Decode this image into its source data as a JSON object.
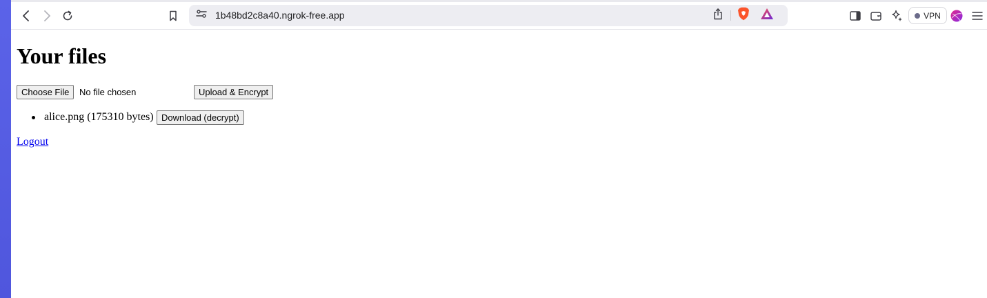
{
  "browser": {
    "url": "1b48bd2c8a40.ngrok-free.app",
    "vpn_label": "VPN",
    "icons": {
      "back": "chevron-left-icon",
      "forward": "chevron-right-icon",
      "reload": "reload-icon",
      "bookmark": "bookmark-icon",
      "site_settings": "tune-icon",
      "share": "share-icon",
      "brave_shields": "brave-lion-icon",
      "rewards": "rewards-triangle-icon",
      "sidebar": "sidebar-icon",
      "wallet": "wallet-icon",
      "leo": "sparkle-icon",
      "profile": "profile-avatar-icon",
      "menu": "hamburger-menu-icon"
    },
    "colors": {
      "left_strip": "#5b63e8",
      "brave_orange": "#fb542b",
      "rewards_purple": "#6b2bd9"
    }
  },
  "page": {
    "heading": "Your files",
    "file_input": {
      "button_label": "Choose File",
      "status": "No file chosen"
    },
    "upload_button": "Upload & Encrypt",
    "files": [
      {
        "text": "alice.png (175310 bytes)",
        "download_label": "Download (decrypt)"
      }
    ],
    "logout_label": "Logout",
    "link_color": "#0000ee"
  }
}
